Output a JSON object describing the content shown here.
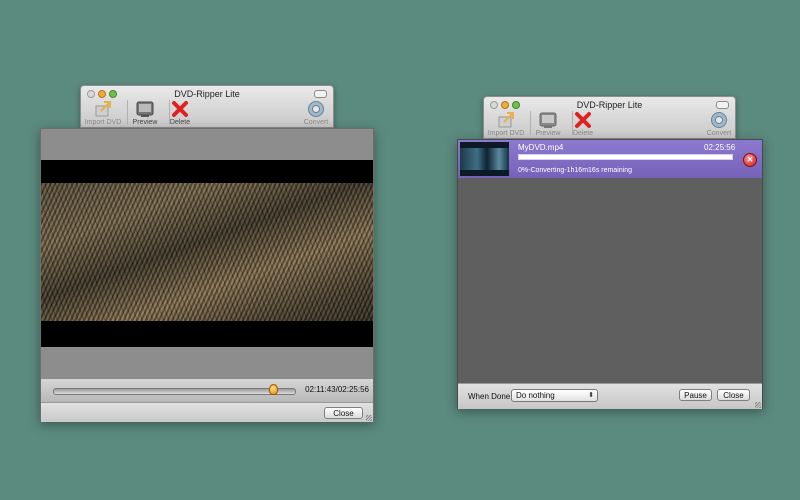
{
  "app": {
    "title": "DVD-Ripper Lite"
  },
  "toolbar": {
    "import_label": "Import DVD",
    "preview_label": "Preview",
    "delete_label": "Delete",
    "convert_label": "Convert"
  },
  "preview_window": {
    "time_readout": "02:11:43/02:25:56",
    "playback_progress": 0.9,
    "close_label": "Close"
  },
  "convert_window": {
    "job": {
      "file_name": "MyDVD.mp4",
      "duration": "02:25:56",
      "progress": 0.0,
      "status": "0%-Converting-1h16m16s remaining"
    },
    "when_done_label": "When Done",
    "when_done_value": "Do nothing",
    "pause_label": "Pause",
    "close_label": "Close"
  },
  "colors": {
    "desktop": "#5b8a7e",
    "selected_row": "#7c68bf",
    "progress_fill": "#4e8de0"
  },
  "icons": [
    "import-dvd-icon",
    "preview-icon",
    "delete-icon",
    "convert-icon",
    "cancel-icon"
  ]
}
